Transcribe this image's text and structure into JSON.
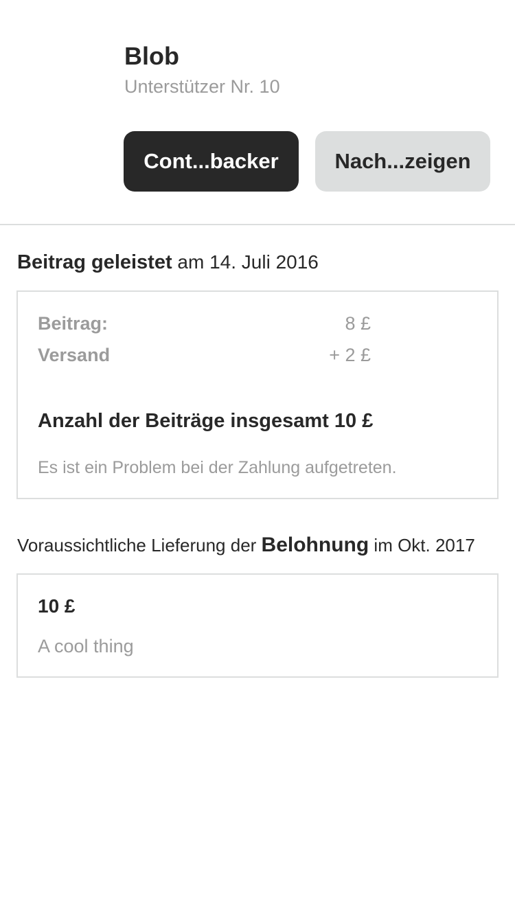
{
  "backer": {
    "name": "Blob",
    "number": "Unterstützer Nr. 10"
  },
  "actions": {
    "contact_label": "Cont...backer",
    "messages_label": "Nach...zeigen"
  },
  "pledge": {
    "heading_strong": "Beitrag geleistet",
    "heading_date": " am 14. Juli 2016",
    "rows": [
      {
        "label": "Beitrag:",
        "value": "8 £"
      },
      {
        "label": "Versand",
        "value": "+ 2 £"
      }
    ],
    "total": "Anzahl der Beiträge insgesamt 10 £",
    "status_message": "Es ist ein Problem bei der Zahlung aufgetreten."
  },
  "delivery": {
    "prefix": "Voraussichtliche Lieferung der ",
    "strong": "Belohnung",
    "suffix": " im Okt. 2017"
  },
  "reward": {
    "amount": "10 £",
    "description": "A cool thing"
  },
  "colors": {
    "text_primary": "#282828",
    "text_secondary": "#9b9b9b",
    "border": "#dcdede",
    "button_dark": "#282828",
    "button_light": "#dcdede"
  }
}
